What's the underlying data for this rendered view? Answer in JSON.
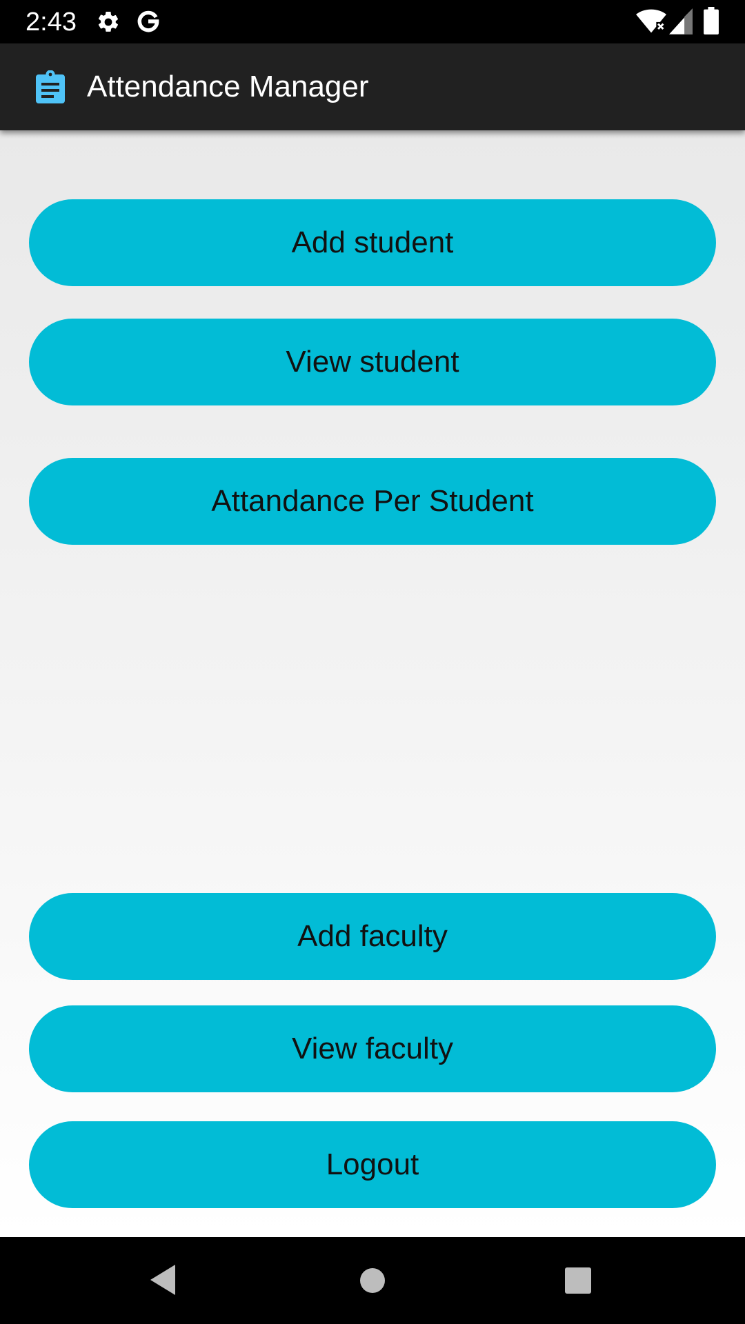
{
  "status_bar": {
    "time": "2:43",
    "icons": [
      "gear-icon",
      "google-g-icon",
      "wifi-icon",
      "signal-icon",
      "battery-icon"
    ]
  },
  "app_bar": {
    "title": "Attendance Manager",
    "icon": "clipboard-icon",
    "icon_color": "#4fc3f7"
  },
  "buttons": {
    "add_student": "Add student",
    "view_student": "View student",
    "attendance_per_student": "Attandance Per Student",
    "add_faculty": "Add faculty",
    "view_faculty": "View faculty",
    "logout": "Logout"
  },
  "colors": {
    "button": "#02bcd6",
    "app_bar": "#212121"
  },
  "nav_bar": {
    "icons": [
      "back-icon",
      "home-icon",
      "recents-icon"
    ]
  }
}
